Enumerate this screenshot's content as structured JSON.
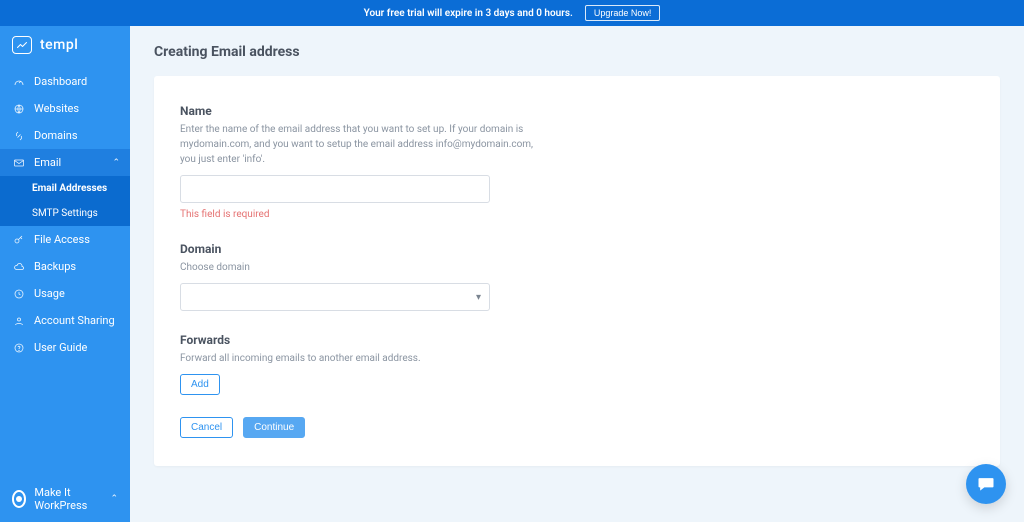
{
  "banner": {
    "text": "Your free trial will expire in 3 days and 0 hours.",
    "cta": "Upgrade Now!"
  },
  "brand": {
    "name": "templ"
  },
  "sidebar": {
    "items": [
      {
        "label": "Dashboard"
      },
      {
        "label": "Websites"
      },
      {
        "label": "Domains"
      },
      {
        "label": "Email",
        "expanded": true
      },
      {
        "label": "Email Addresses",
        "sub": true,
        "selected": true
      },
      {
        "label": "SMTP Settings",
        "sub": true
      },
      {
        "label": "File Access"
      },
      {
        "label": "Backups"
      },
      {
        "label": "Usage"
      },
      {
        "label": "Account Sharing"
      },
      {
        "label": "User Guide"
      }
    ],
    "footer": "Make It WorkPress"
  },
  "page": {
    "title": "Creating Email address"
  },
  "form": {
    "name": {
      "label": "Name",
      "help": "Enter the name of the email address that you want to set up. If your domain is mydomain.com, and you want to setup the email address info@mydomain.com, you just enter 'info'.",
      "value": "",
      "error": "This field is required"
    },
    "domain": {
      "label": "Domain",
      "help": "Choose domain",
      "selected": ""
    },
    "forwards": {
      "label": "Forwards",
      "help": "Forward all incoming emails to another email address.",
      "add": "Add"
    },
    "actions": {
      "cancel": "Cancel",
      "continue": "Continue"
    }
  }
}
